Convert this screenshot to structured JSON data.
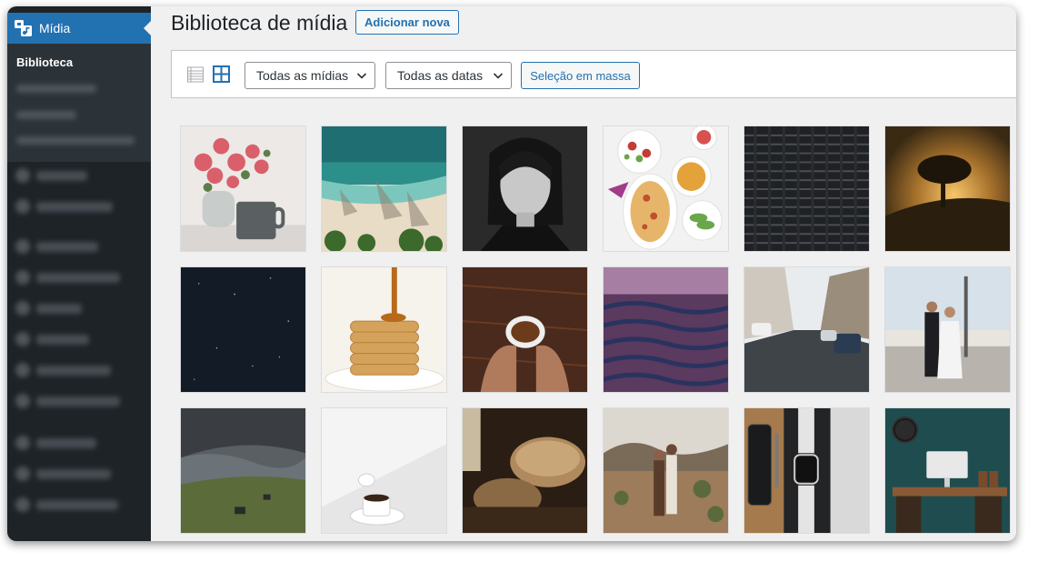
{
  "sidebar": {
    "menu_label": "Mídia",
    "submenu_current": "Biblioteca"
  },
  "page": {
    "title": "Biblioteca de mídia",
    "add_new_label": "Adicionar nova"
  },
  "toolbar": {
    "media_filter": "Todas as mídias",
    "date_filter": "Todas as datas",
    "bulk_select_label": "Seleção em massa"
  },
  "colors": {
    "sidebar_bg": "#1d2327",
    "accent": "#2271b1",
    "page_bg": "#f0f0f1"
  },
  "media_items": [
    {
      "name": "pink-roses-and-mug"
    },
    {
      "name": "aerial-beach-palm-shadows"
    },
    {
      "name": "bw-woman-portrait"
    },
    {
      "name": "food-plates-top-view"
    },
    {
      "name": "tower-building-facade"
    },
    {
      "name": "tree-sunset-silhouette"
    },
    {
      "name": "starry-night-sky"
    },
    {
      "name": "pancakes-syrup"
    },
    {
      "name": "hands-holding-coffee"
    },
    {
      "name": "ocean-waves-dusk"
    },
    {
      "name": "city-street-cars"
    },
    {
      "name": "wedding-couple-bridge"
    },
    {
      "name": "cloudy-hills-landscape"
    },
    {
      "name": "coffee-cup-minimal"
    },
    {
      "name": "bread-loaf-dark"
    },
    {
      "name": "couple-desert-field"
    },
    {
      "name": "phone-and-smartwatch"
    },
    {
      "name": "workspace-desk-wall"
    }
  ]
}
